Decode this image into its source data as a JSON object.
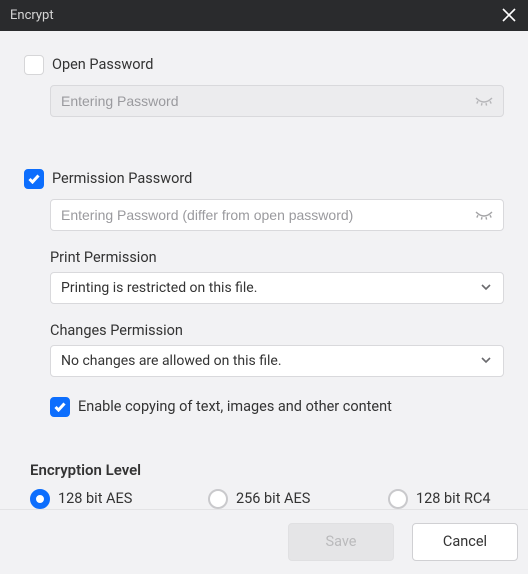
{
  "dialog": {
    "title": "Encrypt"
  },
  "openPassword": {
    "checked": false,
    "label": "Open Password",
    "placeholder": "Entering Password"
  },
  "permissionPassword": {
    "checked": true,
    "label": "Permission Password",
    "placeholder": "Entering Password (differ from open password)"
  },
  "printPermission": {
    "label": "Print Permission",
    "value": "Printing is restricted on this file."
  },
  "changesPermission": {
    "label": "Changes Permission",
    "value": "No changes are allowed on this file."
  },
  "enableCopy": {
    "checked": true,
    "label": "Enable copying of text, images and other content"
  },
  "encryption": {
    "title": "Encryption Level",
    "options": [
      "128 bit AES",
      "256 bit AES",
      "128 bit RC4"
    ],
    "selected": 0
  },
  "buttons": {
    "save": "Save",
    "cancel": "Cancel"
  }
}
